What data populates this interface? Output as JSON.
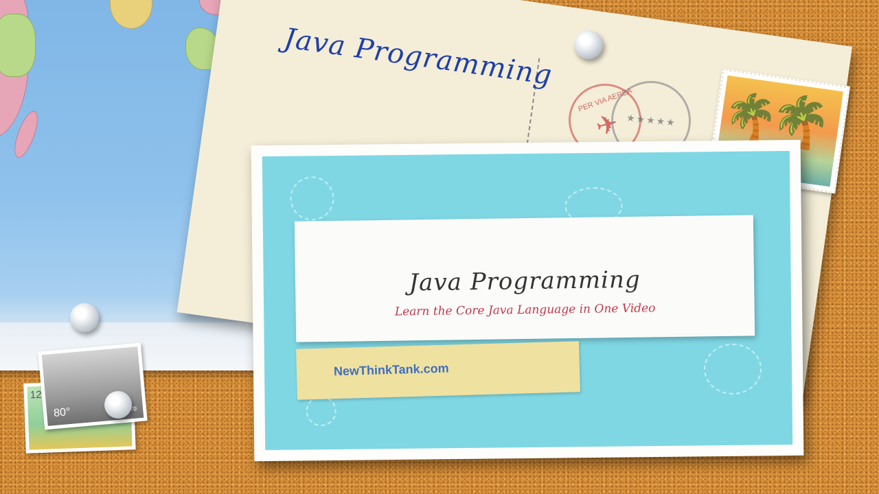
{
  "postcard": {
    "handwritten_title": "Java Programming",
    "airmail_text": "PER VIA AEREA",
    "postmark_stars": "★★★★★"
  },
  "card": {
    "title": "Java Programming",
    "subtitle": "Learn the Core Java Language in One Video",
    "site": "NewThinkTank.com"
  },
  "stamps": {
    "front_value": "80°",
    "front_small": "中华",
    "back_value": "12"
  },
  "icons": {
    "plane": "✈",
    "palm": "🌴"
  },
  "colors": {
    "cork": "#d9913a",
    "card_teal": "#7fd7e4",
    "title_text": "#333333",
    "subtitle_text": "#c0394a",
    "link": "#3f6fbf",
    "handwriting": "#1f3fa8"
  }
}
